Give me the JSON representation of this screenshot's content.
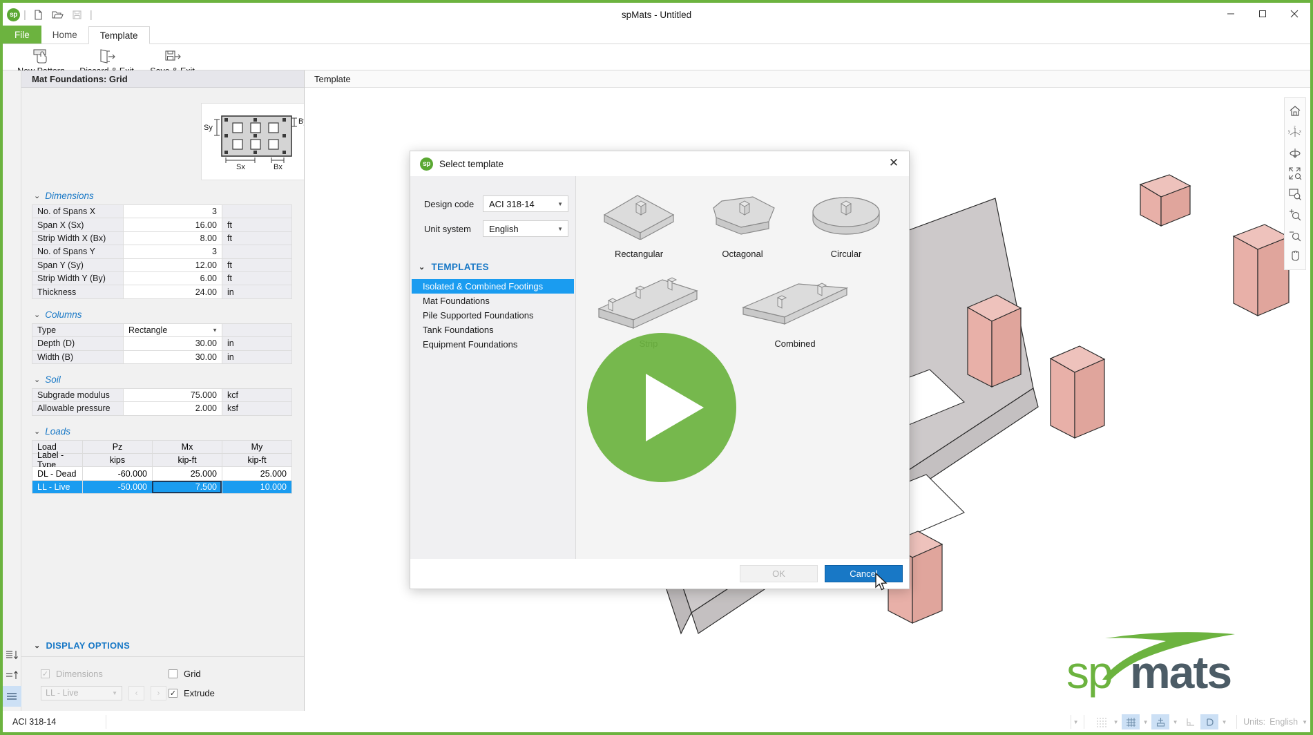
{
  "window": {
    "title": "spMats - Untitled",
    "app_logo": "sp",
    "minimize": "minimize-icon",
    "maximize": "maximize-icon",
    "close": "close-icon",
    "quick_access": [
      "new-file-icon",
      "open-folder-icon",
      "save-icon"
    ]
  },
  "ribbon": {
    "tabs": [
      {
        "label": "File",
        "active": false,
        "kind": "file"
      },
      {
        "label": "Home",
        "active": false,
        "kind": "normal"
      },
      {
        "label": "Template",
        "active": true,
        "kind": "normal"
      }
    ],
    "buttons": [
      {
        "label": "New Pattern",
        "icon": "new-pattern-icon"
      },
      {
        "label": "Discard & Exit",
        "icon": "discard-exit-icon"
      },
      {
        "label": "Save & Exit",
        "icon": "save-exit-icon"
      }
    ]
  },
  "left_panel": {
    "header": "Mat Foundations: Grid",
    "figure": {
      "label_sy": "Sy",
      "label_by": "By",
      "label_sx": "Sx",
      "label_bx": "Bx"
    },
    "sections": [
      {
        "title": "Dimensions",
        "rows": [
          {
            "name": "No. of Spans X",
            "value": "3",
            "unit": ""
          },
          {
            "name": "Span X (Sx)",
            "value": "16.00",
            "unit": "ft"
          },
          {
            "name": "Strip Width X (Bx)",
            "value": "8.00",
            "unit": "ft"
          },
          {
            "name": "No. of Spans Y",
            "value": "3",
            "unit": ""
          },
          {
            "name": "Span Y (Sy)",
            "value": "12.00",
            "unit": "ft"
          },
          {
            "name": "Strip Width Y (By)",
            "value": "6.00",
            "unit": "ft"
          },
          {
            "name": "Thickness",
            "value": "24.00",
            "unit": "in"
          }
        ]
      },
      {
        "title": "Columns",
        "rows": [
          {
            "name": "Type",
            "value": "Rectangle",
            "unit": "",
            "dropdown": true
          },
          {
            "name": "Depth (D)",
            "value": "30.00",
            "unit": "in"
          },
          {
            "name": "Width (B)",
            "value": "30.00",
            "unit": "in"
          }
        ]
      },
      {
        "title": "Soil",
        "rows": [
          {
            "name": "Subgrade modulus",
            "value": "75.000",
            "unit": "kcf"
          },
          {
            "name": "Allowable pressure",
            "value": "2.000",
            "unit": "ksf"
          }
        ]
      }
    ],
    "loads": {
      "title": "Loads",
      "header_row": [
        "Load",
        "Pz",
        "Mx",
        "My"
      ],
      "unit_row": [
        "Label - Type",
        "kips",
        "kip-ft",
        "kip-ft"
      ],
      "rows": [
        {
          "cells": [
            "DL - Dead",
            "-60.000",
            "25.000",
            "25.000"
          ],
          "selected": false,
          "focused_index": -1
        },
        {
          "cells": [
            "LL - Live",
            "-50.000",
            "7.500",
            "10.000"
          ],
          "selected": true,
          "focused_index": 2
        }
      ]
    },
    "display_options": {
      "title": "DISPLAY OPTIONS",
      "dimensions_label": "Dimensions",
      "dimensions_checked": true,
      "dimensions_disabled": true,
      "load_case_value": "LL - Live",
      "prev_label": "‹",
      "next_label": "›",
      "grid_label": "Grid",
      "grid_checked": false,
      "extrude_label": "Extrude",
      "extrude_checked": true
    },
    "rail_icons": [
      "sort-descending-icon",
      "sort-ascending-icon",
      "list-view-icon"
    ]
  },
  "main_view": {
    "tab_label": "Template",
    "toolbar_icons": [
      "home-view-icon",
      "axis-orientation-icon",
      "rotate-view-icon",
      "zoom-fit-icon",
      "zoom-window-icon",
      "zoom-in-icon",
      "zoom-out-icon",
      "pan-hand-icon"
    ],
    "axis_labels": {
      "x": "x",
      "y": "y"
    },
    "logo_text": "spmats",
    "logo_sp": "sp",
    "logo_mats": "mats"
  },
  "dialog": {
    "title": "Select template",
    "close_label": "✕",
    "design_code_label": "Design code",
    "design_code_value": "ACI 318-14",
    "unit_system_label": "Unit system",
    "unit_system_value": "English",
    "templates_header": "TEMPLATES",
    "templates": [
      {
        "label": "Isolated & Combined Footings",
        "selected": true
      },
      {
        "label": "Mat Foundations",
        "selected": false
      },
      {
        "label": "Pile Supported Foundations",
        "selected": false
      },
      {
        "label": "Tank Foundations",
        "selected": false
      },
      {
        "label": "Equipment Foundations",
        "selected": false
      }
    ],
    "thumbnails_row1": [
      {
        "label": "Rectangular",
        "shape": "rectangular-footing-icon"
      },
      {
        "label": "Octagonal",
        "shape": "octagonal-footing-icon"
      },
      {
        "label": "Circular",
        "shape": "circular-footing-icon"
      }
    ],
    "thumbnails_row2": [
      {
        "label": "Strip",
        "shape": "strip-footing-icon"
      },
      {
        "label": "Combined",
        "shape": "combined-footing-icon"
      }
    ],
    "ok_label": "OK",
    "cancel_label": "Cancel"
  },
  "overlay": {
    "play_button": "play-button-icon"
  },
  "status_bar": {
    "design_code": "ACI 318-14",
    "icons": [
      {
        "name": "dot-grid-icon",
        "active": false,
        "has_arrow": true
      },
      {
        "name": "grid-icon",
        "active": true,
        "has_arrow": true
      },
      {
        "name": "snap-icon",
        "active": true,
        "has_arrow": true
      },
      {
        "name": "ortho-icon",
        "active": false,
        "has_arrow": false
      },
      {
        "name": "polar-icon",
        "active": true,
        "has_arrow": true
      }
    ],
    "units_label": "Units:",
    "units_value": "English"
  },
  "colors": {
    "brand_green": "#6cb33f",
    "accent_blue": "#1878c6",
    "selection_blue": "#1a9cf0",
    "column_pink": "#e8b4ae",
    "slab_gray": "#cdc9ca"
  }
}
